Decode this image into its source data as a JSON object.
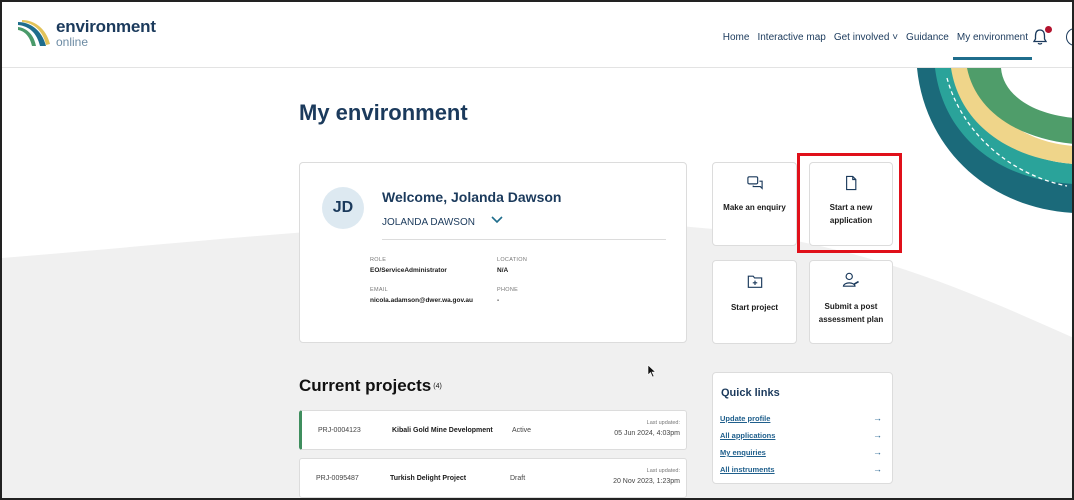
{
  "header": {
    "logo_main": "environment",
    "logo_sub": "online",
    "nav": [
      "Home",
      "Interactive map",
      "Get involved ˅",
      "Guidance",
      "My environment"
    ],
    "active_nav": "My environment",
    "notification_icon": "bell-icon",
    "help_icon": "help-icon"
  },
  "page": {
    "title": "My environment"
  },
  "welcome": {
    "initials": "JD",
    "greeting": "Welcome, Jolanda Dawson",
    "username": "JOLANDA DAWSON",
    "role_label": "ROLE",
    "role_value": "EO/ServiceAdministrator",
    "location_label": "LOCATION",
    "location_value": "N/A",
    "email_label": "EMAIL",
    "email_value": "nicola.adamson@dwer.wa.gov.au",
    "phone_label": "PHONE",
    "phone_value": "-"
  },
  "actions": [
    {
      "label": "Make an enquiry",
      "icon": "chat-icon"
    },
    {
      "label": "Start a new application",
      "icon": "document-icon"
    },
    {
      "label": "Start project",
      "icon": "add-folder-icon"
    },
    {
      "label": "Submit a post assessment plan",
      "icon": "user-plan-icon"
    }
  ],
  "projects": {
    "title": "Current projects",
    "count": "(4)",
    "rows": [
      {
        "id": "PRJ-0004123",
        "name": "Kibali Gold Mine Development",
        "status": "Active",
        "updated_label": "Last updated:",
        "updated": "05 Jun 2024, 4:03pm"
      },
      {
        "id": "PRJ-0095487",
        "name": "Turkish Delight Project",
        "status": "Draft",
        "updated_label": "Last updated:",
        "updated": "20 Nov 2023, 1:23pm"
      }
    ]
  },
  "quick_links": {
    "title": "Quick links",
    "items": [
      "Update profile",
      "All applications",
      "My enquiries",
      "All instruments"
    ],
    "arrow": "→"
  },
  "colors": {
    "brand_navy": "#1b3a5c",
    "accent_teal": "#1f6d8c",
    "highlight_red": "#e0101a",
    "active_green": "#3f8e5e"
  }
}
